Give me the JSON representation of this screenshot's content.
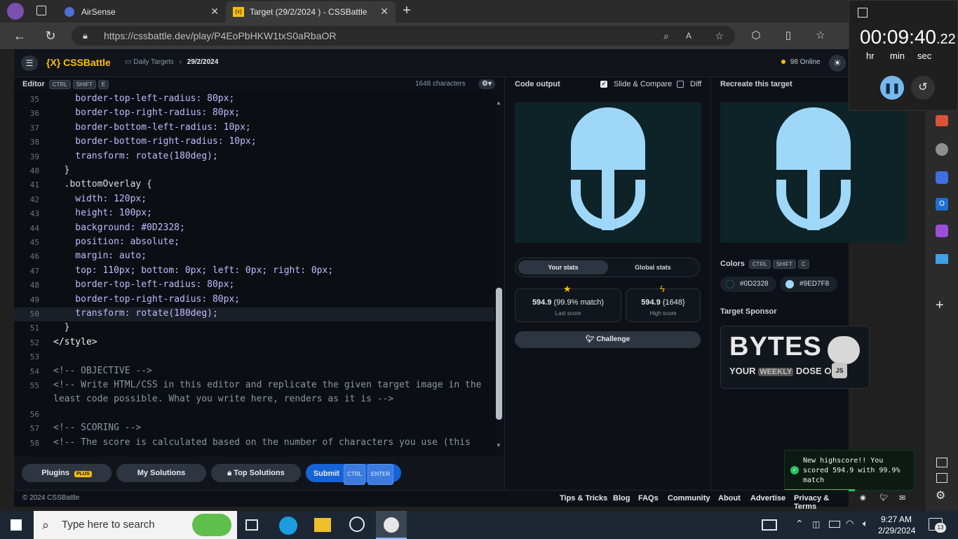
{
  "browser": {
    "tabs": [
      {
        "title": "AirSense"
      },
      {
        "title": "Target (29/2/2024 ) - CSSBattle"
      }
    ],
    "url": "https://cssbattle.dev/play/P4EoPbHKW1txS0aRbaOR"
  },
  "app": {
    "logo": "CSSBattle",
    "breadcrumb": [
      "Daily Targets",
      "29/2/2024"
    ],
    "online": "98 Online",
    "editor_label": "Editor",
    "editor_keys": [
      "CTRL",
      "SHIFT",
      "E"
    ],
    "characters": "1648 characters",
    "code_output_label": "Code output",
    "slide_compare": "Slide & Compare",
    "diff": "Diff",
    "recreate_label": "Recreate this target",
    "stats_tabs": [
      "Your stats",
      "Global stats"
    ],
    "last_score_value": "594.9",
    "last_score_match": "(99.9% match)",
    "last_score_label": "Last score",
    "high_score_value": "594.9",
    "high_score_chars": "{1648}",
    "high_score_label": "High score",
    "challenge": "Challenge",
    "colors_label": "Colors",
    "colors_keys": [
      "CTRL",
      "SHIFT",
      "C"
    ],
    "colors": [
      {
        "hex": "#0D2328"
      },
      {
        "hex": "#9ED7F8"
      }
    ],
    "sponsor_label": "Target Sponsor",
    "sponsor_title": "BYTES",
    "sponsor_tagline_1": "YOUR",
    "sponsor_tagline_2": "WEEKLY",
    "sponsor_tagline_3": "DOSE OF",
    "sponsor_badge": "JS",
    "buttons": {
      "plugins": "Plugins",
      "plugins_badge": "PLUS",
      "my_solutions": "My Solutions",
      "top_solutions": "Top Solutions",
      "submit": "Submit",
      "submit_keys": [
        "CTRL",
        "ENTER"
      ]
    },
    "footer": {
      "copyright": "© 2024 CSSBattle",
      "links": [
        "Tips & Tricks",
        "Blog",
        "FAQs",
        "Community",
        "About",
        "Advertise",
        "Privacy & Terms"
      ]
    },
    "toast": "New highscore!! You scored 594.9 with 99.9% match"
  },
  "editor": {
    "lines": [
      {
        "n": "35",
        "text": "    border-top-left-radius: 80px;"
      },
      {
        "n": "36",
        "text": "    border-top-right-radius: 80px;"
      },
      {
        "n": "37",
        "text": "    border-bottom-left-radius: 10px;"
      },
      {
        "n": "38",
        "text": "    border-bottom-right-radius: 10px;"
      },
      {
        "n": "39",
        "text": "    transform: rotate(180deg);"
      },
      {
        "n": "40",
        "text": "  }"
      },
      {
        "n": "41",
        "text": "  .bottomOverlay {"
      },
      {
        "n": "42",
        "text": "    width: 120px;"
      },
      {
        "n": "43",
        "text": "    height: 100px;"
      },
      {
        "n": "44",
        "text": "    background: #0D2328;"
      },
      {
        "n": "45",
        "text": "    position: absolute;"
      },
      {
        "n": "46",
        "text": "    margin: auto;"
      },
      {
        "n": "47",
        "text": "    top: 110px; bottom: 0px; left: 0px; right: 0px;"
      },
      {
        "n": "48",
        "text": "    border-top-left-radius: 80px;"
      },
      {
        "n": "49",
        "text": "    border-top-right-radius: 80px;"
      },
      {
        "n": "50",
        "text": "    transform: rotate(180deg);"
      },
      {
        "n": "51",
        "text": "  }"
      },
      {
        "n": "52",
        "text": "</style>"
      },
      {
        "n": "53",
        "text": ""
      },
      {
        "n": "54",
        "text": "<!-- OBJECTIVE -->"
      },
      {
        "n": "55",
        "text": "<!-- Write HTML/CSS in this editor and replicate the given target image in the"
      },
      {
        "n": "",
        "text": "least code possible. What you write here, renders as it is -->"
      },
      {
        "n": "56",
        "text": ""
      },
      {
        "n": "57",
        "text": "<!-- SCORING -->"
      },
      {
        "n": "58",
        "text": "<!-- The score is calculated based on the number of characters you use (this"
      }
    ]
  },
  "clock": {
    "time": "00:09:40",
    "fraction": ".22",
    "units": [
      "hr",
      "min",
      "sec"
    ]
  },
  "taskbar": {
    "search_placeholder": "Type here to search",
    "time": "9:27 AM",
    "date": "2/29/2024",
    "notifications": "13"
  }
}
